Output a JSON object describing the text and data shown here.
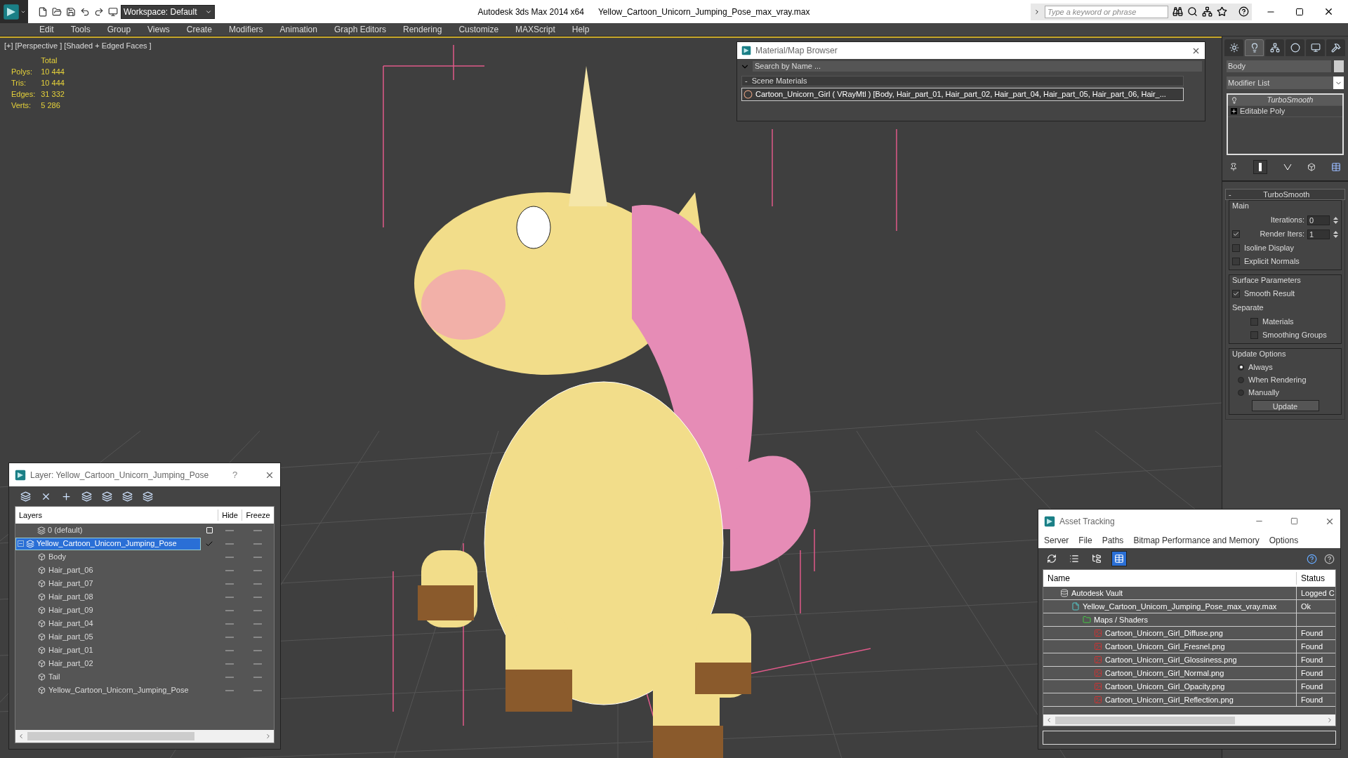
{
  "title_bar": {
    "workspace": "Workspace: Default",
    "app_title": "Autodesk 3ds Max  2014 x64",
    "file_name": "Yellow_Cartoon_Unicorn_Jumping_Pose_max_vray.max",
    "search": {
      "placeholder": "Type a keyword or phrase"
    }
  },
  "menu": [
    "Edit",
    "Tools",
    "Group",
    "Views",
    "Create",
    "Modifiers",
    "Animation",
    "Graph Editors",
    "Rendering",
    "Customize",
    "MAXScript",
    "Help"
  ],
  "viewport": {
    "labels": [
      "[+]",
      "[Perspective ]",
      "[Shaded + Edged Faces ]"
    ],
    "stats": {
      "header": "Total",
      "rows": [
        {
          "label": "Polys:",
          "value": "10 444"
        },
        {
          "label": "Tris:",
          "value": "10 444"
        },
        {
          "label": "Edges:",
          "value": "31 332"
        },
        {
          "label": "Verts:",
          "value": "5 286"
        }
      ]
    }
  },
  "material_browser": {
    "title": "Material/Map Browser",
    "search": {
      "placeholder": "Search by Name ..."
    },
    "group": {
      "toggle": "-",
      "label": "Scene Materials"
    },
    "items": [
      {
        "text": "Cartoon_Unicorn_Girl  ( VRayMtl )  [Body, Hair_part_01, Hair_part_02, Hair_part_04, Hair_part_05, Hair_part_06, Hair_..."
      }
    ]
  },
  "layer_window": {
    "title": "Layer: Yellow_Cartoon_Unicorn_Jumping_Pose",
    "help": "?",
    "columns": [
      "Layers",
      "Hide",
      "Freeze"
    ],
    "layers": [
      {
        "name": "0 (default)",
        "current": false,
        "selected": false
      },
      {
        "name": "Yellow_Cartoon_Unicorn_Jumping_Pose",
        "current": true,
        "selected": true,
        "expanded": true,
        "children": [
          {
            "name": "Body"
          },
          {
            "name": "Hair_part_06"
          },
          {
            "name": "Hair_part_07"
          },
          {
            "name": "Hair_part_08"
          },
          {
            "name": "Hair_part_09"
          },
          {
            "name": "Hair_part_04"
          },
          {
            "name": "Hair_part_05"
          },
          {
            "name": "Hair_part_01"
          },
          {
            "name": "Hair_part_02"
          },
          {
            "name": "Tail"
          },
          {
            "name": "Yellow_Cartoon_Unicorn_Jumping_Pose"
          }
        ]
      }
    ]
  },
  "command_panel": {
    "tabs": [
      {
        "kind": "create",
        "selected": false
      },
      {
        "kind": "modify",
        "selected": true
      },
      {
        "kind": "hierarchy",
        "selected": false
      },
      {
        "kind": "motion",
        "selected": false
      },
      {
        "kind": "display",
        "selected": false
      },
      {
        "kind": "utilities",
        "selected": false
      }
    ],
    "object_name": "Body",
    "modifier_list": "Modifier List",
    "stack": [
      {
        "kind": "modifier",
        "label": "TurboSmooth",
        "selected": true
      },
      {
        "kind": "base",
        "label": "Editable Poly",
        "selected": false
      }
    ],
    "rollout": {
      "toggle": "-",
      "title": "TurboSmooth",
      "groups": [
        {
          "title": "Main",
          "controls": [
            {
              "kind": "spinner",
              "label": "Iterations:",
              "value": "0"
            },
            {
              "kind": "checkbox_spinner",
              "label": "Render Iters:",
              "value": "1",
              "checked": true
            },
            {
              "kind": "checkbox",
              "label": "Isoline Display",
              "checked": false
            },
            {
              "kind": "checkbox",
              "label": "Explicit Normals",
              "checked": false
            }
          ]
        },
        {
          "title": "Surface Parameters",
          "controls": [
            {
              "kind": "checkbox",
              "label": "Smooth Result",
              "checked": true
            },
            {
              "kind": "label",
              "label": "Separate"
            },
            {
              "kind": "sub_checkbox",
              "label": "Materials",
              "checked": false
            },
            {
              "kind": "sub_checkbox",
              "label": "Smoothing Groups",
              "checked": false
            }
          ]
        },
        {
          "title": "Update Options",
          "controls": [
            {
              "kind": "radio",
              "label": "Always",
              "selected": true
            },
            {
              "kind": "radio",
              "label": "When Rendering",
              "selected": false
            },
            {
              "kind": "radio",
              "label": "Manually",
              "selected": false
            },
            {
              "kind": "button",
              "label": "Update"
            }
          ]
        }
      ]
    }
  },
  "asset_tracking": {
    "title": "Asset Tracking",
    "menu": [
      "Server",
      "File",
      "Paths",
      "Bitmap Performance and Memory",
      "Options"
    ],
    "toolbar": [
      {
        "kind": "refresh",
        "selected": false
      },
      {
        "kind": "list",
        "selected": false
      },
      {
        "kind": "tree",
        "selected": false
      },
      {
        "kind": "table",
        "selected": true
      }
    ],
    "columns": [
      "Name",
      "Status"
    ],
    "rows": [
      {
        "kind": "vault",
        "name": "Autodesk Vault",
        "status": "Logged C",
        "children": [
          {
            "kind": "max",
            "name": "Yellow_Cartoon_Unicorn_Jumping_Pose_max_vray.max",
            "status": "Ok",
            "children": [
              {
                "kind": "folder",
                "name": "Maps / Shaders",
                "children": [
                  {
                    "kind": "png",
                    "name": "Cartoon_Unicorn_Girl_Diffuse.png",
                    "status": "Found"
                  },
                  {
                    "kind": "png",
                    "name": "Cartoon_Unicorn_Girl_Fresnel.png",
                    "status": "Found"
                  },
                  {
                    "kind": "png",
                    "name": "Cartoon_Unicorn_Girl_Glossiness.png",
                    "status": "Found"
                  },
                  {
                    "kind": "png",
                    "name": "Cartoon_Unicorn_Girl_Normal.png",
                    "status": "Found"
                  },
                  {
                    "kind": "png",
                    "name": "Cartoon_Unicorn_Girl_Opacity.png",
                    "status": "Found"
                  },
                  {
                    "kind": "png",
                    "name": "Cartoon_Unicorn_Girl_Reflection.png",
                    "status": "Found"
                  }
                ]
              }
            ]
          }
        ]
      }
    ]
  }
}
